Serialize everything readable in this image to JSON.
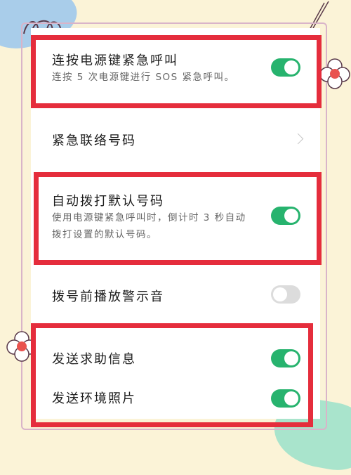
{
  "settings": {
    "sos_power": {
      "title": "连按电源键紧急呼叫",
      "desc": "连按 5 次电源键进行 SOS 紧急呼叫。",
      "enabled": true
    },
    "emergency_contacts": {
      "title": "紧急联络号码"
    },
    "auto_dial": {
      "title": "自动拨打默认号码",
      "desc_line1": "使用电源键紧急呼叫时，倒计时 3 秒自动",
      "desc_line2": "拨打设置的默认号码。",
      "enabled": true
    },
    "warning_sound": {
      "title": "拨号前播放警示音",
      "enabled": false
    },
    "send_help_info": {
      "title": "发送求助信息",
      "enabled": true
    },
    "send_photos": {
      "title": "发送环境照片",
      "enabled": true
    }
  },
  "colors": {
    "toggle_on": "#27b36e",
    "toggle_off": "#dcdcdc",
    "highlight": "#e52d3c",
    "background": "#fbf3d7"
  },
  "icons": [
    "chevron-right-icon"
  ]
}
